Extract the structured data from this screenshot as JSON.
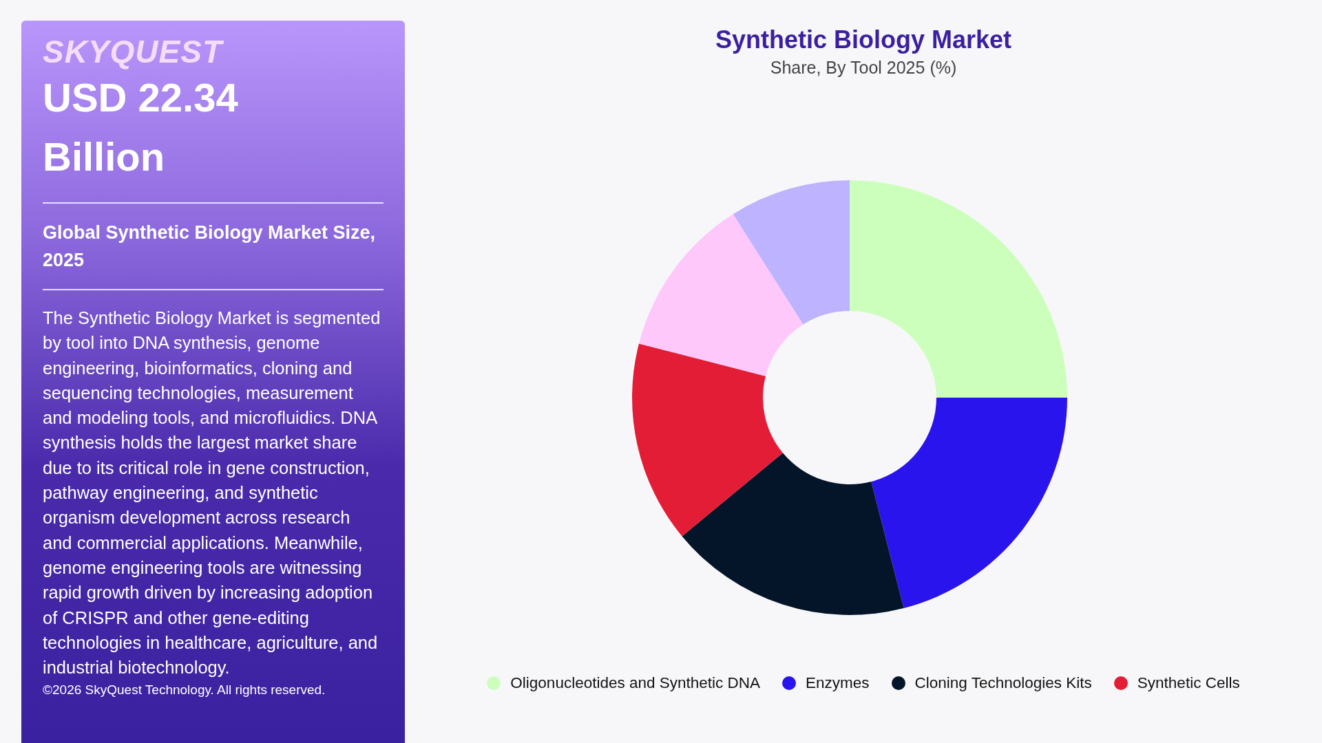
{
  "panel": {
    "logo": "SKYQUEST",
    "value_line_1": "USD 22.34",
    "value_line_2": "Billion",
    "subtitle": "Global Synthetic Biology Market Size, 2025",
    "description": "The Synthetic Biology Market is segmented by tool into DNA synthesis, genome engineering, bioinformatics, cloning and sequencing technologies, measurement and modeling tools, and microfluidics. DNA synthesis holds the largest market share due to its critical role in gene construction, pathway engineering, and synthetic organism development across research and commercial applications. Meanwhile, genome engineering tools are witnessing rapid growth driven by increasing adoption of CRISPR and other gene-editing technologies in healthcare, agriculture, and industrial biotechnology.",
    "copyright": "©2026 SkyQuest Technology. All rights reserved."
  },
  "chart": {
    "title": "Synthetic Biology Market",
    "subtitle": "Share, By Tool 2025 (%)",
    "legend": [
      {
        "label": "Oligonucleotides and Synthetic DNA",
        "color": "#ccffbb"
      },
      {
        "label": "Enzymes",
        "color": "#2a14ee"
      },
      {
        "label": "Cloning Technologies Kits",
        "color": "#04152a"
      },
      {
        "label": "Synthetic Cells",
        "color": "#e41d37"
      }
    ]
  }
}
